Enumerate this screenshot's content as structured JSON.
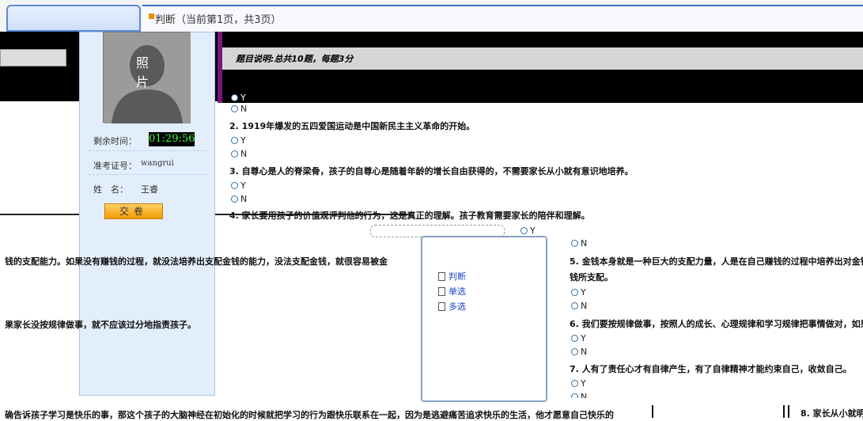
{
  "tab": {
    "title": "判断（当前第1页，共3页）"
  },
  "exam_info": {
    "photo_label": "照片",
    "remaining_time_label": "剩余时间：",
    "remaining_time": "01:29:56",
    "ticket_label": "准考证号：",
    "ticket_value": "wangrui",
    "name_label": "姓　名：",
    "name_value": "王睿",
    "submit_label": "交卷"
  },
  "section": {
    "header": "题目说明:总共10题，每题3分"
  },
  "questions": [
    {
      "text": "2. 1919年爆发的五四爱国运动是中国新民主主义革命的开始。",
      "opt_y": "Y",
      "opt_n": "N"
    },
    {
      "text": "3. 自尊心是人的脊梁骨，孩子的自尊心是随着年龄的增长自由获得的，不需要家长从小就有意识地培养。",
      "opt_y": "Y",
      "opt_n": "N"
    },
    {
      "text": "4. 家长要用孩子的价值观评判他的行为，这是真正的理解。孩子教育需要家长的陪伴和理解。"
    }
  ],
  "q1_opts": {
    "opt_y": "Y",
    "opt_n": "N"
  },
  "right_col": {
    "opt_n_top": "N",
    "opt_y_top": "Y",
    "q5": "5. 金钱本身就是一种巨大的支配力量，人是在自己赚钱的过程中培养出对金钱",
    "q5_cont": "钱所支配。",
    "q6": "6. 我们要按规律做事，按照人的成长、心理规律和学习规律把事情做对，如果",
    "q7": "7. 人有了责任心才有自律产生，有了自律精神才能约束自己，收敛自己。",
    "q8": "8. 家长从小就明",
    "opt_y": "Y",
    "opt_n": "N"
  },
  "left_col": {
    "line1": "钱的支配能力。如果没有赚钱的过程，就没法培养出支配金钱的能力，没法支配金钱，就很容易被金",
    "line2": "果家长没按规律做事，就不应该过分地指责孩子。",
    "line3": "确告诉孩子学习是快乐的事，那这个孩子的大脑神经在初始化的时候就把学习的行为跟快乐联系在一起，因为是逃避痛苦追求快乐的生活，他才愿意自己快乐的"
  },
  "tree": {
    "items": [
      "判断",
      "单选",
      "多选"
    ]
  }
}
